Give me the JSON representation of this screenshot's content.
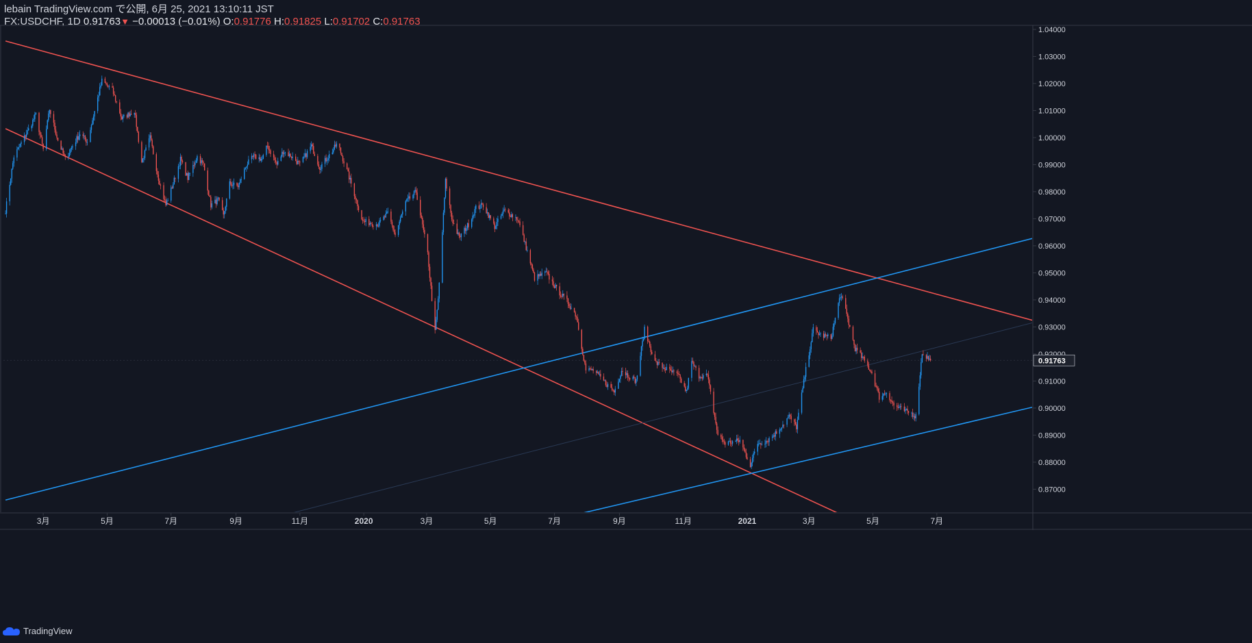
{
  "header": {
    "line1": "lebain TradingView.com で公開, 6月 25, 2021 13:10:11 JST",
    "symbol": "FX:USDCHF, 1D",
    "last": "0.91763",
    "change_arrow": "▼",
    "change": "−0.00013 (−0.01%)",
    "o_label": "O:",
    "o_val": "0.91776",
    "h_label": "H:",
    "h_val": "0.91825",
    "l_label": "L:",
    "l_val": "0.91702",
    "c_label": "C:",
    "c_val": "0.91763"
  },
  "footer": {
    "brand": "TradingView",
    "logo_icon": "tradingview-cloud-icon"
  },
  "colors": {
    "background": "#131722",
    "up": "#2196f3",
    "down": "#ef5350",
    "grid": "#363a45",
    "text": "#d1d4dc",
    "price_label_bg": "#1e222d"
  },
  "chart_data": {
    "type": "candlestick",
    "symbol": "FX:USDCHF",
    "interval": "1D",
    "x_ticks": [
      "3月",
      "5月",
      "7月",
      "9月",
      "11月",
      "2020",
      "3月",
      "5月",
      "7月",
      "9月",
      "11月",
      "2021",
      "3月",
      "5月",
      "7月"
    ],
    "y_ticks": [
      "0.87000",
      "0.88000",
      "0.89000",
      "0.90000",
      "0.91000",
      "0.92000",
      "0.93000",
      "0.94000",
      "0.95000",
      "0.96000",
      "0.97000",
      "0.98000",
      "0.99000",
      "1.00000",
      "1.01000",
      "1.02000",
      "1.03000",
      "1.04000"
    ],
    "ylim": [
      0.8615,
      1.0415
    ],
    "xlim": [
      "2019-01-22",
      "2021-09-30"
    ],
    "last_price": "0.91763",
    "series_points": [
      [
        "2019-01-24",
        0.973
      ],
      [
        "2019-02-01",
        0.993
      ],
      [
        "2019-02-15",
        1.003
      ],
      [
        "2019-02-22",
        1.0085
      ],
      [
        "2019-03-01",
        0.9955
      ],
      [
        "2019-03-07",
        1.0105
      ],
      [
        "2019-03-15",
        0.999
      ],
      [
        "2019-03-22",
        0.992
      ],
      [
        "2019-03-29",
        0.997
      ],
      [
        "2019-04-05",
        1.0015
      ],
      [
        "2019-04-12",
        0.9985
      ],
      [
        "2019-04-26",
        1.021
      ],
      [
        "2019-05-06",
        1.0175
      ],
      [
        "2019-05-15",
        1.007
      ],
      [
        "2019-05-27",
        1.01
      ],
      [
        "2019-06-03",
        0.991
      ],
      [
        "2019-06-11",
        1.0
      ],
      [
        "2019-06-19",
        0.985
      ],
      [
        "2019-06-26",
        0.975
      ],
      [
        "2019-07-03",
        0.983
      ],
      [
        "2019-07-10",
        0.992
      ],
      [
        "2019-07-17",
        0.985
      ],
      [
        "2019-07-26",
        0.993
      ],
      [
        "2019-08-01",
        0.99
      ],
      [
        "2019-08-08",
        0.975
      ],
      [
        "2019-08-15",
        0.977
      ],
      [
        "2019-08-20",
        0.971
      ],
      [
        "2019-08-26",
        0.983
      ],
      [
        "2019-09-03",
        0.982
      ],
      [
        "2019-09-11",
        0.99
      ],
      [
        "2019-09-18",
        0.993
      ],
      [
        "2019-09-26",
        0.992
      ],
      [
        "2019-10-01",
        0.997
      ],
      [
        "2019-10-10",
        0.99
      ],
      [
        "2019-10-16",
        0.995
      ],
      [
        "2019-10-24",
        0.993
      ],
      [
        "2019-11-01",
        0.99
      ],
      [
        "2019-11-12",
        0.997
      ],
      [
        "2019-11-20",
        0.989
      ],
      [
        "2019-12-01",
        0.9945
      ],
      [
        "2019-12-07",
        0.998
      ],
      [
        "2019-12-20",
        0.983
      ],
      [
        "2019-12-31",
        0.969
      ],
      [
        "2020-01-15",
        0.968
      ],
      [
        "2020-01-24",
        0.972
      ],
      [
        "2020-01-31",
        0.964
      ],
      [
        "2020-02-10",
        0.976
      ],
      [
        "2020-02-20",
        0.98
      ],
      [
        "2020-03-02",
        0.957
      ],
      [
        "2020-03-09",
        0.928
      ],
      [
        "2020-03-12",
        0.94
      ],
      [
        "2020-03-19",
        0.984
      ],
      [
        "2020-03-25",
        0.97
      ],
      [
        "2020-04-01",
        0.963
      ],
      [
        "2020-04-10",
        0.968
      ],
      [
        "2020-04-17",
        0.974
      ],
      [
        "2020-04-24",
        0.975
      ],
      [
        "2020-05-05",
        0.967
      ],
      [
        "2020-05-14",
        0.973
      ],
      [
        "2020-05-27",
        0.97
      ],
      [
        "2020-06-05",
        0.958
      ],
      [
        "2020-06-12",
        0.948
      ],
      [
        "2020-06-23",
        0.95
      ],
      [
        "2020-07-03",
        0.944
      ],
      [
        "2020-07-14",
        0.939
      ],
      [
        "2020-07-22",
        0.934
      ],
      [
        "2020-07-31",
        0.914
      ],
      [
        "2020-08-07",
        0.914
      ],
      [
        "2020-08-17",
        0.91
      ],
      [
        "2020-08-27",
        0.906
      ],
      [
        "2020-09-03",
        0.914
      ],
      [
        "2020-09-17",
        0.91
      ],
      [
        "2020-09-25",
        0.929
      ],
      [
        "2020-10-05",
        0.917
      ],
      [
        "2020-10-13",
        0.915
      ],
      [
        "2020-10-27",
        0.912
      ],
      [
        "2020-11-04",
        0.906
      ],
      [
        "2020-11-09",
        0.917
      ],
      [
        "2020-11-16",
        0.912
      ],
      [
        "2020-11-24",
        0.912
      ],
      [
        "2020-12-04",
        0.89
      ],
      [
        "2020-12-11",
        0.887
      ],
      [
        "2020-12-25",
        0.888
      ],
      [
        "2021-01-04",
        0.879
      ],
      [
        "2021-01-11",
        0.887
      ],
      [
        "2021-01-20",
        0.888
      ],
      [
        "2021-01-29",
        0.891
      ],
      [
        "2021-02-10",
        0.897
      ],
      [
        "2021-02-17",
        0.893
      ],
      [
        "2021-02-25",
        0.912
      ],
      [
        "2021-03-05",
        0.929
      ],
      [
        "2021-03-12",
        0.927
      ],
      [
        "2021-03-22",
        0.926
      ],
      [
        "2021-03-31",
        0.942
      ],
      [
        "2021-04-05",
        0.936
      ],
      [
        "2021-04-14",
        0.922
      ],
      [
        "2021-04-22",
        0.918
      ],
      [
        "2021-04-30",
        0.913
      ],
      [
        "2021-05-07",
        0.904
      ],
      [
        "2021-05-14",
        0.906
      ],
      [
        "2021-05-21",
        0.901
      ],
      [
        "2021-05-31",
        0.899
      ],
      [
        "2021-06-07",
        0.898
      ],
      [
        "2021-06-11",
        0.897
      ],
      [
        "2021-06-17",
        0.9205
      ],
      [
        "2021-06-25",
        0.91763
      ]
    ],
    "trend_lines": [
      {
        "color": "down",
        "points": [
          [
            "2019-01-24",
            1.0357
          ],
          [
            "2021-09-30",
            0.9325
          ]
        ]
      },
      {
        "color": "down",
        "points": [
          [
            "2019-01-24",
            1.0033
          ],
          [
            "2021-09-30",
            0.828
          ]
        ]
      },
      {
        "color": "up",
        "points": [
          [
            "2019-01-24",
            0.866
          ],
          [
            "2021-09-30",
            0.9627
          ]
        ]
      },
      {
        "color": "up",
        "points": [
          [
            "2019-01-24",
            0.811
          ],
          [
            "2021-09-30",
            0.9003
          ]
        ]
      },
      {
        "color": "faint",
        "points": [
          [
            "2019-01-24",
            0.834
          ],
          [
            "2021-09-30",
            0.9315
          ]
        ]
      }
    ]
  }
}
